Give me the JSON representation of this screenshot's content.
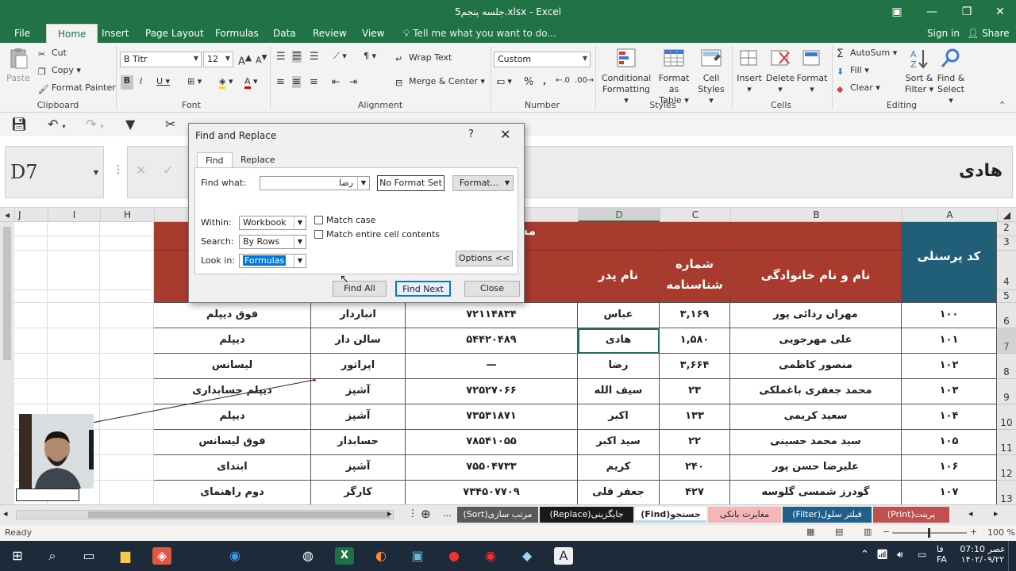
{
  "window": {
    "title": "جلسه پنجم5.xlsx - Excel"
  },
  "tabs": [
    "File",
    "Home",
    "Insert",
    "Page Layout",
    "Formulas",
    "Data",
    "Review",
    "View"
  ],
  "tell_me": "Tell me what you want to do...",
  "sign_in": "Sign in",
  "share": "Share",
  "ribbon": {
    "clipboard": {
      "paste": "Paste",
      "cut": "Cut",
      "copy": "Copy",
      "format_painter": "Format Painter",
      "label": "Clipboard"
    },
    "font": {
      "name": "B Titr",
      "size": "12",
      "label": "Font"
    },
    "alignment": {
      "wrap": "Wrap Text",
      "merge": "Merge & Center",
      "label": "Alignment"
    },
    "number": {
      "format": "Custom",
      "label": "Number"
    },
    "styles": {
      "cond": [
        "Conditional",
        "Formatting"
      ],
      "table": [
        "Format as",
        "Table"
      ],
      "cell": [
        "Cell",
        "Styles"
      ],
      "label": "Styles"
    },
    "cells": {
      "insert": "Insert",
      "delete": "Delete",
      "format": "Format",
      "label": "Cells"
    },
    "editing": {
      "autosum": "AutoSum",
      "fill": "Fill",
      "clear": "Clear",
      "sort": [
        "Sort &",
        "Filter"
      ],
      "find": [
        "Find &",
        "Select"
      ],
      "label": "Editing"
    }
  },
  "namebox": "D7",
  "formula_value": "هادی",
  "columns": {
    "J": "J",
    "I": "I",
    "H": "H",
    "D": "D",
    "C": "C",
    "B": "B",
    "A": "A"
  },
  "table": {
    "title_fragment": "مشخ",
    "headers": {
      "personnel_code": "کد پرسنلی",
      "full_name": "نام و نام خانوادگی",
      "id_number": [
        "شماره",
        "شناسنامه"
      ],
      "father_name": "نام پدر"
    },
    "rows": [
      {
        "row": "6",
        "code": "۱۰۰",
        "name": "مهران ردائی پور",
        "id": "۳,۱۶۹",
        "father": "عباس",
        "phone": "۷۲۱۱۴۸۳۴",
        "job": "انباردار",
        "edu": "فوق دیپلم"
      },
      {
        "row": "7",
        "code": "۱۰۱",
        "name": "علی مهرجویی",
        "id": "۱,۵۸۰",
        "father": "هادی",
        "phone": "۵۴۴۲۰۴۸۹",
        "job": "سالن دار",
        "edu": "دیپلم"
      },
      {
        "row": "8",
        "code": "۱۰۲",
        "name": "منصور کاظمی",
        "id": "۳,۶۶۴",
        "father": "رضا",
        "phone": "—",
        "job": "اپراتور",
        "edu": "لیسانس"
      },
      {
        "row": "9",
        "code": "۱۰۳",
        "name": "محمد جعفری باغملکی",
        "id": "۲۳",
        "father": "سیف الله",
        "phone": "۷۲۵۲۷۰۶۶",
        "job": "آشپز",
        "edu": "دیپلم حسابداری"
      },
      {
        "row": "10",
        "code": "۱۰۴",
        "name": "سعید کریمی",
        "id": "۱۳۳",
        "father": "اکبر",
        "phone": "۷۳۵۳۱۸۷۱",
        "job": "آشپز",
        "edu": "دیپلم"
      },
      {
        "row": "11",
        "code": "۱۰۵",
        "name": "سید محمد حسینی",
        "id": "۲۲",
        "father": "سید اکبر",
        "phone": "۷۸۵۴۱۰۵۵",
        "job": "حسابدار",
        "edu": "فوق لیسانس"
      },
      {
        "row": "12",
        "code": "۱۰۶",
        "name": "علیرضا حسن پور",
        "id": "۲۴۰",
        "father": "کریم",
        "phone": "۷۵۵۰۴۷۳۳",
        "job": "آشپز",
        "edu": "ابتدای"
      },
      {
        "row": "13",
        "code": "۱۰۷",
        "name": "گودرز شمسی گلوسه",
        "id": "۴۲۷",
        "father": "جعفر قلی",
        "phone": "۷۳۴۵۰۷۷۰۹",
        "job": "کارگر",
        "edu": "دوم راهنمای"
      }
    ],
    "row_headers_top": [
      "2",
      "3",
      "4",
      "5"
    ]
  },
  "sheet_tabs": [
    "پرینت(Print)",
    "فیلتر سلول(Filter)",
    "مغایرت بانکی",
    "جستجو(Find)",
    "جایگزینی(Replace)",
    "مرتب سازی(Sort)"
  ],
  "sheet_tab_colors": [
    "#c0504d",
    "#1f5f8b",
    "#f4b6b6",
    "#b7dde8",
    "#1a1a1a",
    "#5a5a5a"
  ],
  "status": {
    "ready": "Ready",
    "zoom": "100 %"
  },
  "dialog": {
    "title": "Find and Replace",
    "help": "?",
    "tab_find": "Find",
    "tab_replace": "Replace",
    "find_what_label": "Find what:",
    "find_what_value": "رضا",
    "no_format": "No Format Set",
    "format_btn": "Format...",
    "within_label": "Within:",
    "within_value": "Workbook",
    "search_label": "Search:",
    "search_value": "By Rows",
    "lookin_label": "Look in:",
    "lookin_value": "Formulas",
    "match_case": "Match case",
    "match_entire": "Match entire cell contents",
    "options_btn": "Options <<",
    "find_all": "Find All",
    "find_next": "Find Next",
    "close": "Close"
  },
  "taskbar": {
    "time": "07:10 عصر",
    "date": "۱۴۰۲/۰۹/۲۲",
    "lang": "FA",
    "lang2": "فا"
  }
}
